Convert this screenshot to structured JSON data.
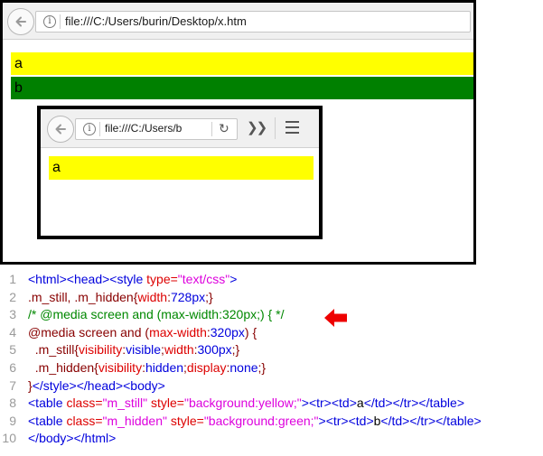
{
  "browser_large": {
    "url": "file:///C:/Users/burin/Desktop/x.htm",
    "rows": [
      {
        "text": "a",
        "bg": "#ffff00"
      },
      {
        "text": "b",
        "bg": "#008000"
      }
    ]
  },
  "browser_small": {
    "url": "file:///C:/Users/b",
    "rows": [
      {
        "text": "a",
        "bg": "#ffff00"
      }
    ]
  },
  "colors": {
    "tag": "#0000dd",
    "attr": "#dd0000",
    "value": "#dd00dd",
    "comment": "#008800",
    "arrow": "#ee0000"
  },
  "code": {
    "lines": [
      {
        "num": "1",
        "tokens": [
          {
            "t": "<html><head><style ",
            "c": "tag"
          },
          {
            "t": "type=",
            "c": "attr"
          },
          {
            "t": "\"text/css\"",
            "c": "val"
          },
          {
            "t": ">",
            "c": "tag"
          }
        ]
      },
      {
        "num": "2",
        "tokens": [
          {
            "t": ".m_still, .m_hidden{",
            "c": "css"
          },
          {
            "t": "width",
            "c": "prop"
          },
          {
            "t": ":",
            "c": "css"
          },
          {
            "t": "728px",
            "c": "cval"
          },
          {
            "t": ";}",
            "c": "css"
          }
        ]
      },
      {
        "num": "3",
        "tokens": [
          {
            "t": "/* @media screen and (max-width:320px;) { */",
            "c": "comment"
          }
        ]
      },
      {
        "num": "4",
        "tokens": [
          {
            "t": "@media screen and (",
            "c": "css"
          },
          {
            "t": "max-width",
            "c": "prop"
          },
          {
            "t": ":",
            "c": "css"
          },
          {
            "t": "320px",
            "c": "cval"
          },
          {
            "t": ") {",
            "c": "css"
          }
        ]
      },
      {
        "num": "5",
        "tokens": [
          {
            "t": "  .m_still{",
            "c": "css"
          },
          {
            "t": "visibility",
            "c": "prop"
          },
          {
            "t": ":",
            "c": "css"
          },
          {
            "t": "visible",
            "c": "cval"
          },
          {
            "t": ";",
            "c": "css"
          },
          {
            "t": "width",
            "c": "prop"
          },
          {
            "t": ":",
            "c": "css"
          },
          {
            "t": "300px",
            "c": "cval"
          },
          {
            "t": ";}",
            "c": "css"
          }
        ]
      },
      {
        "num": "6",
        "tokens": [
          {
            "t": "  .m_hidden{",
            "c": "css"
          },
          {
            "t": "visibility",
            "c": "prop"
          },
          {
            "t": ":",
            "c": "css"
          },
          {
            "t": "hidden",
            "c": "cval"
          },
          {
            "t": ";",
            "c": "css"
          },
          {
            "t": "display",
            "c": "prop"
          },
          {
            "t": ":",
            "c": "css"
          },
          {
            "t": "none",
            "c": "cval"
          },
          {
            "t": ";}",
            "c": "css"
          }
        ]
      },
      {
        "num": "7",
        "tokens": [
          {
            "t": "}",
            "c": "css"
          },
          {
            "t": "</style></head><body>",
            "c": "tag"
          }
        ]
      },
      {
        "num": "8",
        "tokens": [
          {
            "t": "<table ",
            "c": "tag"
          },
          {
            "t": "class=",
            "c": "attr"
          },
          {
            "t": "\"m_still\"",
            "c": "val"
          },
          {
            "t": " style=",
            "c": "attr"
          },
          {
            "t": "\"background:yellow;\"",
            "c": "val"
          },
          {
            "t": "><tr><td>",
            "c": "tag"
          },
          {
            "t": "a",
            "c": "plain"
          },
          {
            "t": "</td></tr></table>",
            "c": "tag"
          }
        ]
      },
      {
        "num": "9",
        "tokens": [
          {
            "t": "<table ",
            "c": "tag"
          },
          {
            "t": "class=",
            "c": "attr"
          },
          {
            "t": "\"m_hidden\"",
            "c": "val"
          },
          {
            "t": " style=",
            "c": "attr"
          },
          {
            "t": "\"background:green;\"",
            "c": "val"
          },
          {
            "t": "><tr><td>",
            "c": "tag"
          },
          {
            "t": "b",
            "c": "plain"
          },
          {
            "t": "</td></tr></table>",
            "c": "tag"
          }
        ]
      },
      {
        "num": "10",
        "tokens": [
          {
            "t": "</body></html>",
            "c": "tag"
          }
        ]
      }
    ]
  }
}
